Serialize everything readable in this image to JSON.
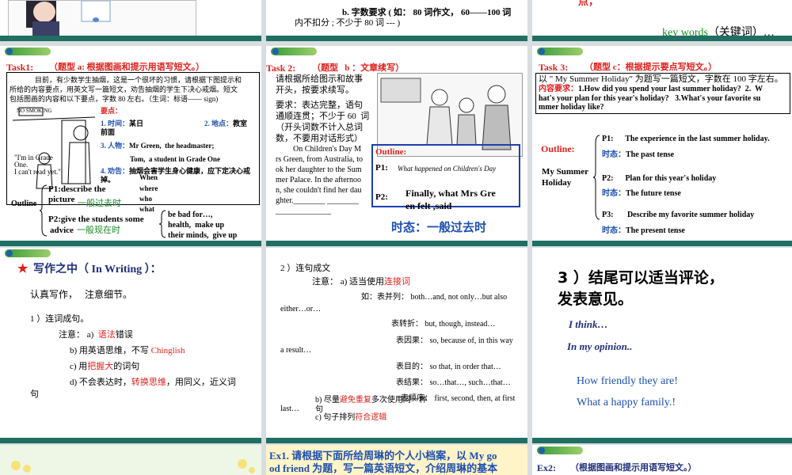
{
  "s1": {
    "caption": ""
  },
  "s2": {
    "line1": "b. 字数要求 ( 如： 80 词作文， 60——100 词",
    "line2": "内不扣分 ; 不少于 80 词 --- )"
  },
  "s3": {
    "tail": "点，",
    "keywords": "key words",
    "keywords_cn": "（关键词）…"
  },
  "s4": {
    "title": "Task1:",
    "subtitle": "（题型 a: 根据图画和提示用语写短文。）",
    "para": [
      "目前，有少数学生抽烟，这是一个很坏的习惯，请根据下图提示和",
      "所给的内容要点，用英文写一篇短文，劝告抽烟的学生下决心戒烟。短文",
      "包括图画的内容和以下要点，字数 80 左右。（生词：标语—— sign)"
    ],
    "sign": "NO SMOKING",
    "speech1": "\"I'm in Grade",
    "speech2": "One.",
    "speech3": "I can't read yet.\"",
    "points_title": "要点：",
    "p1": "1. 时间：",
    "p1v": "某日",
    "p2": "2. 地点：",
    "p2v": "教室",
    "p2v2": "前面",
    "p3": "3. 人物：",
    "p3v": "Mr Green,  the headmaster;",
    "p3v2": "Tom,  a student in Grade One",
    "p4": "4. 劝告：",
    "p4v": "抽烟会害学生身心健康，应下定决心戒",
    "p4v2": "掉。",
    "outline": "Outline",
    "o1": "P1:describe the",
    "o1b": "picture",
    "o1t": "一般过去时",
    "o2": "P2:give the students some",
    "o2b": "advice",
    "o2t": "一般现在时",
    "w1": "When",
    "w2": "where",
    "w3": "who",
    "w4": "what",
    "bad1": "be bad for…,",
    "bad2": "health,  make up",
    "bad3": "their minds,  give up"
  },
  "s5": {
    "title": "Task 2:",
    "subtitle": "（题型   b ：文章续写）",
    "l1": "请根据所给图示和故事",
    "l2": "开头，按要求续写。",
    "l3": "要求：表达完整，语句",
    "l4": "通顺连贯；不少于 60  词",
    "l5": "（开头词数不计入总词",
    "l6": "数，不要用对话形式）",
    "story": [
      "On Children's Day M",
      "rs Green, from Australia, to",
      "ok her daughter to the Sum",
      "mer Palace. In the afternoo",
      "n, she couldn't find her dau",
      "ghter.________ ________",
      "______________"
    ],
    "outline": "Outline:",
    "p1": "P1:",
    "p1v": "What happened on Children's Day",
    "p2": "P2:",
    "p2v1": "Finally, what Mrs Gre",
    "p2v2": "en felt ,said",
    "tense": "时态：一般过去时"
  },
  "s6": {
    "title": "Task 3:",
    "subtitle": "（题型 c：根据提示要点写短文。）",
    "l1": "以 \" My Summer Holiday\" 为题写一篇短文，字数在 100 字左右。",
    "l2a": "内容要求：",
    "l2b": "1.How did you spend your last summer holiday?  2.  W",
    "l3": "hat's your plan for this year's holiday?   3.What's your favorite su",
    "l4": "mmer holiday like?",
    "outline": "Outline:",
    "topic1": "My Summer",
    "topic2": "Holiday",
    "p1": "P1:      The experience in the last summer holiday.",
    "t1": "时态：",
    "t1v": "The past tense",
    "p2": "P2:      Plan for this year's holiday",
    "t2": "时态：",
    "t2v": "The future tense",
    "p3": "P3:       Describe my favorite summer holiday",
    "t3": "时态：",
    "t3v": "The present tense"
  },
  "s7": {
    "title": "写作之中（ In Writing ）：",
    "l1": "认真写作，   注意细节。",
    "l2": "1 ）连词成句。",
    "a": "注意： a)  ",
    "a_red": "语法",
    "a_end": "错误",
    "b": "b) 用英语思维，不写 ",
    "b_red": "Chinglish",
    "c": "c) 用",
    "c_red": "把握大",
    "c_end": "的词句",
    "d": "d) 不会表达时，",
    "d_red": "转换思维",
    "d_end": "，用同义，近义词",
    "d2": "句"
  },
  "s8": {
    "head": "2 ）连句成文",
    "a": "注意： a) 适当使用",
    "a_red": "连接词",
    "e1": "如：表并列： both…and, not only…but also",
    "e1b": "either…or…",
    "e2": "表转折： but, though, instead…",
    "e3": "表因果： so, because of, in this way",
    "e3b": "a result…",
    "e4": "表目的： so that, in order that…",
    "e5": "表结果： so…that…, such…that…",
    "e6": "表顺序： first, second, then, at first",
    "e6b": "last…",
    "b": "b) 尽量",
    "b_red": "避免重复",
    "b_end": "多次使用同一种",
    "b2": "句",
    "c": "c) 句子排列",
    "c_red": "符合逻辑"
  },
  "s9": {
    "head1": "3 ）结尾可以适当评论，",
    "head2": "发表意见。",
    "i1": "I think…",
    "i2": "In my opinion..",
    "e1": "How friendly they are!",
    "e2": "What a happy family.!"
  },
  "s11": {
    "l1": "Ex1. 请根据下面所给周琳的个人小档案，以 My go",
    "l2": "od friend 为题，写一篇英语短文，介绍周琳的基本"
  },
  "s12": {
    "title": "Ex2:",
    "subtitle": "（根据图画和提示用语写短文。）"
  }
}
